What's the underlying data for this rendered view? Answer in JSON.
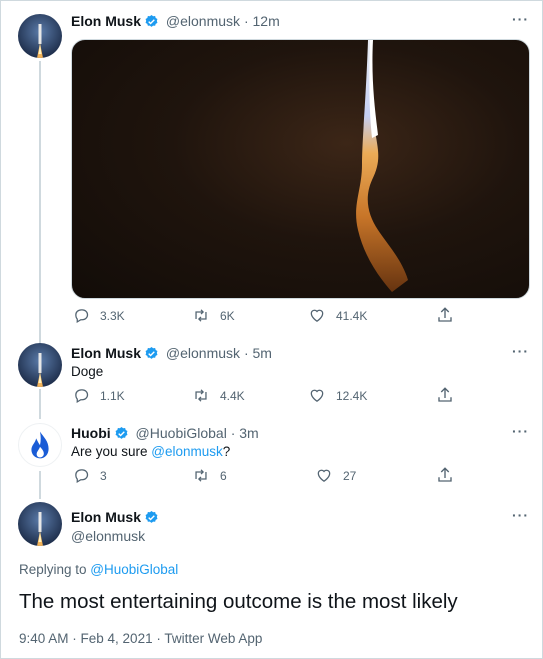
{
  "tweet1": {
    "name": "Elon Musk",
    "handle": "@elonmusk",
    "time": "12m",
    "replies": "3.3K",
    "retweets": "6K",
    "likes": "41.4K"
  },
  "tweet2": {
    "name": "Elon Musk",
    "handle": "@elonmusk",
    "time": "5m",
    "text": "Doge",
    "replies": "1.1K",
    "retweets": "4.4K",
    "likes": "12.4K"
  },
  "tweet3": {
    "name": "Huobi",
    "handle": "@HuobiGlobal",
    "time": "3m",
    "text_prefix": "Are you sure ",
    "text_mention": "@elonmusk",
    "text_suffix": "?",
    "replies": "3",
    "retweets": "6",
    "likes": "27"
  },
  "main_tweet": {
    "name": "Elon Musk",
    "handle": "@elonmusk",
    "replying_prefix": "Replying to ",
    "replying_handle": "@HuobiGlobal",
    "text": "The most entertaining outcome is the most likely",
    "meta": "9:40 AM · Feb 4, 2021 · Twitter Web App"
  },
  "separator": "·",
  "more_label": "···",
  "icons": [
    "verified-badge-icon",
    "reply-icon",
    "retweet-icon",
    "like-icon",
    "share-icon",
    "more-icon",
    "rocket-flame-icon",
    "huobi-flame-icon"
  ],
  "colors": {
    "accent": "#1d9bf0",
    "secondary_text": "#536471",
    "huobi": "#1a5cd6"
  }
}
